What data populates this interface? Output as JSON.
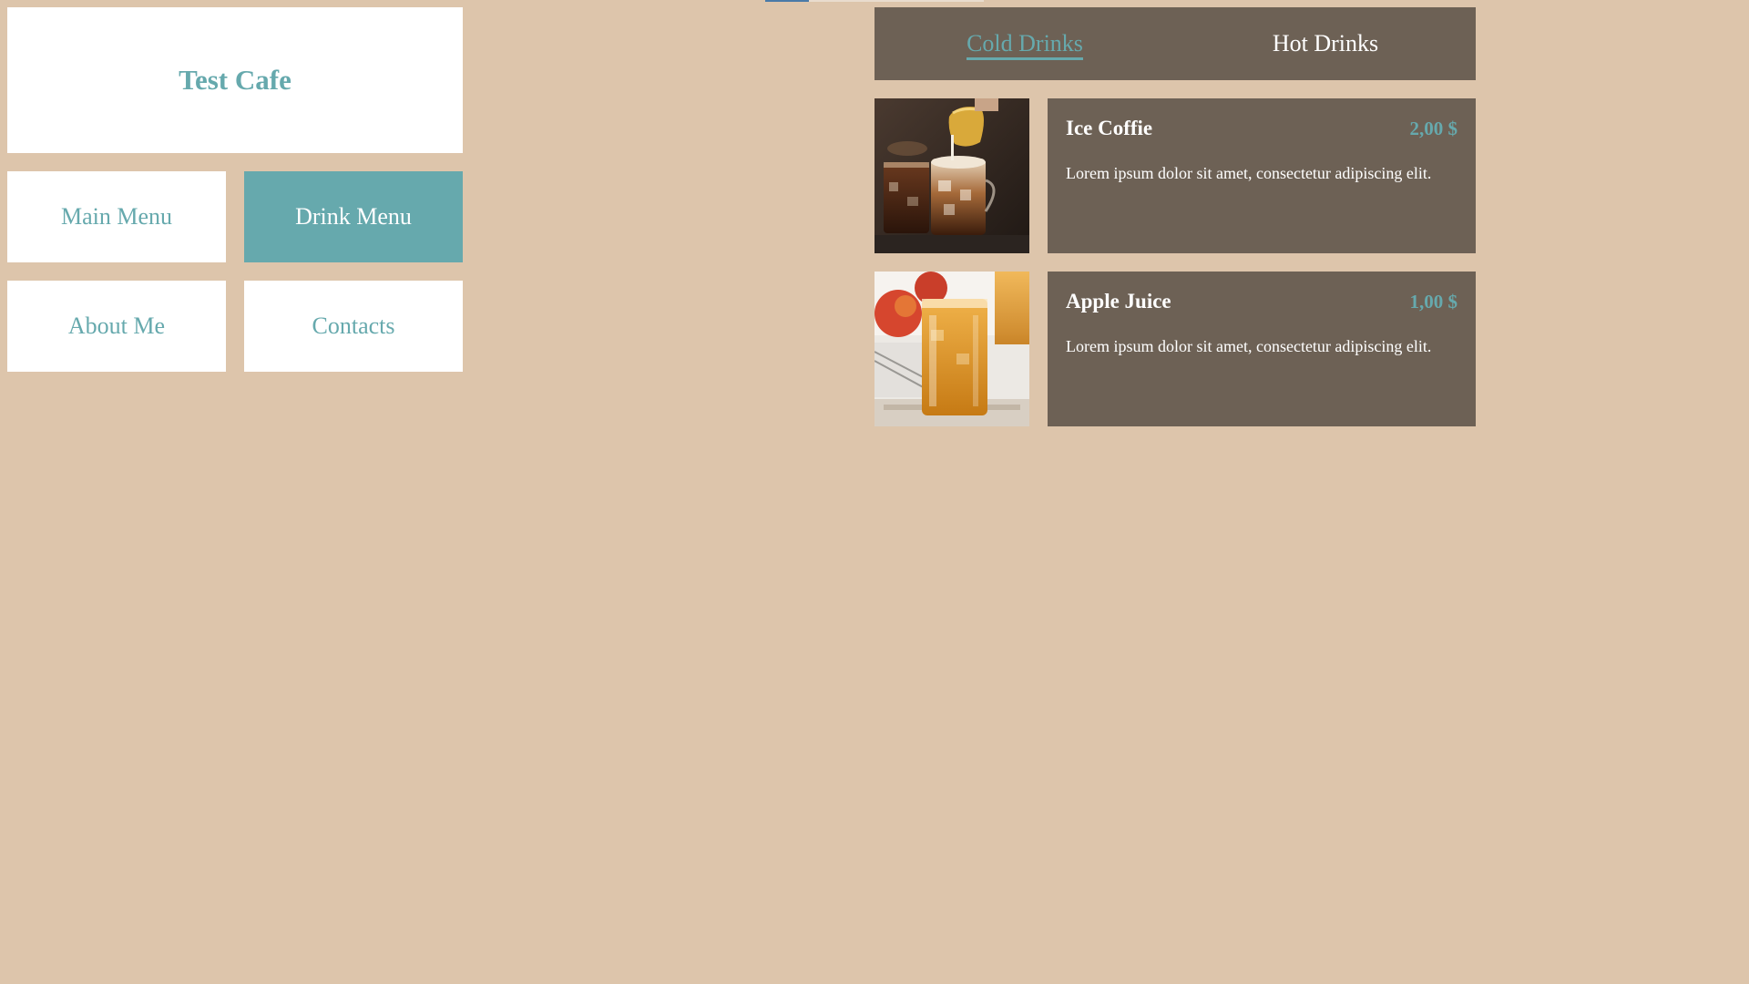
{
  "brand": {
    "title": "Test Cafe"
  },
  "nav": {
    "main_menu": "Main Menu",
    "drink_menu": "Drink Menu",
    "about_me": "About Me",
    "contacts": "Contacts",
    "active": "drink_menu"
  },
  "tabs": {
    "cold": "Cold Drinks",
    "hot": "Hot Drinks",
    "active": "cold"
  },
  "drinks": [
    {
      "name": "Ice Coffie",
      "price": "2,00 $",
      "description": "Lorem ipsum dolor sit amet, consectetur adipiscing elit.",
      "image_icon": "ice-coffee-photo"
    },
    {
      "name": "Apple Juice",
      "price": "1,00 $",
      "description": "Lorem ipsum dolor sit amet, consectetur adipiscing elit.",
      "image_icon": "apple-juice-photo"
    }
  ],
  "colors": {
    "background": "#ddc5ab",
    "accent": "#66a9ad",
    "panel": "#6d6155",
    "white": "#ffffff"
  }
}
